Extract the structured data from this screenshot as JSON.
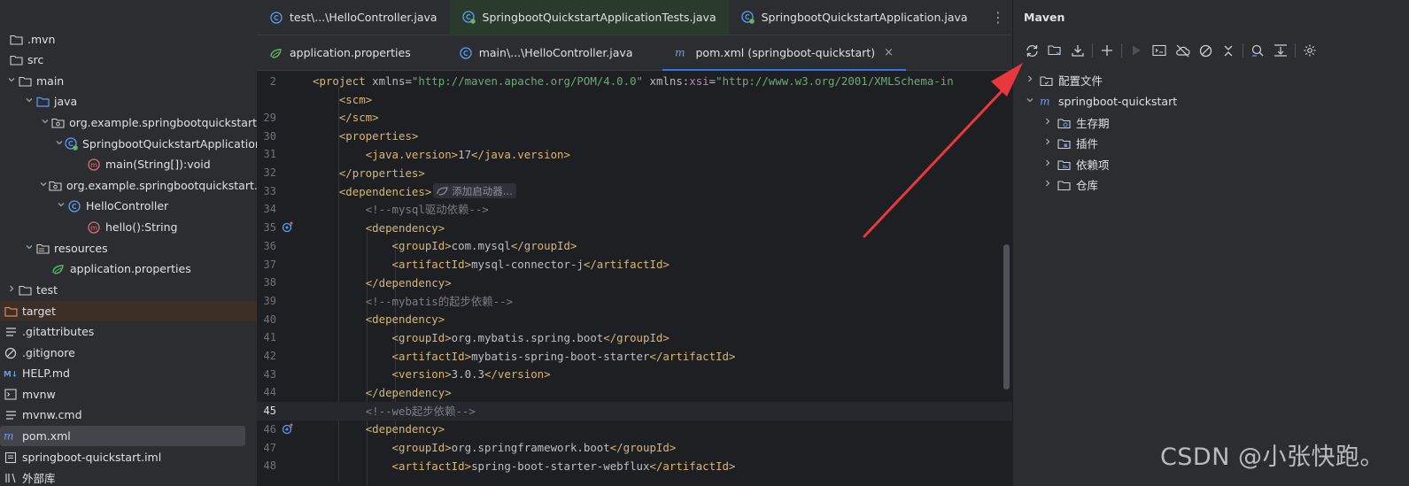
{
  "colors": {
    "accent": "#3574f0",
    "arrow": "#e8383d",
    "tag": "#d5b778",
    "string": "#6aab73",
    "comment": "#7a7e85",
    "namespace": "#c77dbb"
  },
  "tree": {
    "items": [
      {
        "label": ".mvn",
        "icon": "folder-icon"
      },
      {
        "label": "src",
        "icon": "folder-icon"
      },
      {
        "label": "main",
        "icon": "folder-icon"
      },
      {
        "label": "java",
        "icon": "source-folder-icon"
      },
      {
        "label": "org.example.springbootquickstart",
        "icon": "package-icon"
      },
      {
        "label": "SpringbootQuickstartApplication",
        "icon": "spring-class-icon"
      },
      {
        "label": "main(String[]):void",
        "icon": "method-icon"
      },
      {
        "label": "org.example.springbootquickstart.co",
        "icon": "package-icon"
      },
      {
        "label": "HelloController",
        "icon": "class-icon"
      },
      {
        "label": "hello():String",
        "icon": "method-icon"
      },
      {
        "label": "resources",
        "icon": "resources-folder-icon"
      },
      {
        "label": "application.properties",
        "icon": "spring-properties-icon"
      },
      {
        "label": "test",
        "icon": "folder-icon"
      },
      {
        "label": "target",
        "icon": "excluded-folder-icon"
      },
      {
        "label": ".gitattributes",
        "icon": "text-file-icon"
      },
      {
        "label": ".gitignore",
        "icon": "ignore-file-icon"
      },
      {
        "label": "HELP.md",
        "icon": "markdown-icon"
      },
      {
        "label": "mvnw",
        "icon": "shell-file-icon"
      },
      {
        "label": "mvnw.cmd",
        "icon": "text-file-icon"
      },
      {
        "label": "pom.xml",
        "icon": "maven-icon"
      },
      {
        "label": "springboot-quickstart.iml",
        "icon": "iml-file-icon"
      },
      {
        "label": "外部库",
        "icon": "library-icon"
      }
    ]
  },
  "editor": {
    "tabs_row1": [
      {
        "label": "test\\...\\HelloController.java",
        "icon": "class-icon"
      },
      {
        "label": "SpringbootQuickstartApplicationTests.java",
        "icon": "spring-class-icon"
      },
      {
        "label": "SpringbootQuickstartApplication.java",
        "icon": "spring-class-icon"
      }
    ],
    "tabs_row2": [
      {
        "label": "application.properties",
        "icon": "spring-properties-icon"
      },
      {
        "label": "main\\...\\HelloController.java",
        "icon": "class-icon"
      },
      {
        "label": "pom.xml (springboot-quickstart)",
        "icon": "maven-icon",
        "close": "×"
      }
    ],
    "more": "⋮",
    "lines": [
      {
        "n": "2",
        "html": "<span class=\"t\">&lt;project </span><span class=\"an\">xmlns</span>=<span class=\"s\">\"http://maven.apache.org/POM/4.0.0\"</span> <span class=\"an\">xmlns</span>:<span class=\"ns\">xsi</span>=<span class=\"s\">\"http://www.w3.org/2001/XMLSchema-in</span>"
      },
      {
        "n": "",
        "html": "    <span class=\"t\">&lt;scm&gt;</span>"
      },
      {
        "n": "29",
        "html": "    <span class=\"t\">&lt;/scm&gt;</span>"
      },
      {
        "n": "30",
        "html": "    <span class=\"t\">&lt;properties&gt;</span>"
      },
      {
        "n": "31",
        "html": "        <span class=\"t\">&lt;java.version&gt;</span>17<span class=\"t\">&lt;/java.version&gt;</span>"
      },
      {
        "n": "32",
        "html": "    <span class=\"t\">&lt;/properties&gt;</span>"
      },
      {
        "n": "33",
        "html": "    <span class=\"t\">&lt;dependencies&gt;</span>"
      },
      {
        "n": "34",
        "html": "        <span class=\"c\">&lt;!--mysql驱动依赖--&gt;</span>"
      },
      {
        "n": "35",
        "html": "        <span class=\"t\">&lt;dependency&gt;</span>"
      },
      {
        "n": "36",
        "html": "            <span class=\"t\">&lt;groupId&gt;</span>com.mysql<span class=\"t\">&lt;/groupId&gt;</span>"
      },
      {
        "n": "37",
        "html": "            <span class=\"t\">&lt;artifactId&gt;</span>mysql-connector-j<span class=\"t\">&lt;/artifactId&gt;</span>"
      },
      {
        "n": "38",
        "html": "        <span class=\"t\">&lt;/dependency&gt;</span>"
      },
      {
        "n": "39",
        "html": "        <span class=\"c\">&lt;!--mybatis的起步依赖--&gt;</span>"
      },
      {
        "n": "40",
        "html": "        <span class=\"t\">&lt;dependency&gt;</span>"
      },
      {
        "n": "41",
        "html": "            <span class=\"t\">&lt;groupId&gt;</span>org.mybatis.spring.boot<span class=\"t\">&lt;/groupId&gt;</span>"
      },
      {
        "n": "42",
        "html": "            <span class=\"t\">&lt;artifactId&gt;</span>mybatis-spring-boot-starter<span class=\"t\">&lt;/artifactId&gt;</span>"
      },
      {
        "n": "43",
        "html": "            <span class=\"t\">&lt;version&gt;</span>3.0.3<span class=\"t\">&lt;/version&gt;</span>"
      },
      {
        "n": "44",
        "html": "        <span class=\"t\">&lt;/dependency&gt;</span>"
      },
      {
        "n": "45",
        "html": "        <span class=\"c\">&lt;!--web起步依赖--&gt;</span>"
      },
      {
        "n": "46",
        "html": "        <span class=\"t\">&lt;dependency&gt;</span>"
      },
      {
        "n": "47",
        "html": "            <span class=\"t\">&lt;groupId&gt;</span>org.springframework.boot<span class=\"t\">&lt;/groupId&gt;</span>"
      },
      {
        "n": "48",
        "html": "            <span class=\"t\">&lt;artifactId&gt;</span>spring-boot-starter-webflux<span class=\"t\">&lt;/artifactId&gt;</span>"
      }
    ],
    "current_line": "45",
    "inlay_hint": "添加启动器..."
  },
  "maven": {
    "title": "Maven",
    "toolbar": [
      "reload-icon",
      "add-maven-project-icon",
      "download-icon",
      "sep",
      "plus-icon",
      "sep",
      "run-icon",
      "execute-goal-icon",
      "offline-mode-icon",
      "skip-tests-icon",
      "collapse-icon",
      "sep",
      "analyze-dependencies-icon",
      "show-diagram-icon",
      "sep",
      "settings-icon"
    ],
    "tree": [
      {
        "label": "配置文件",
        "icon": "profiles-folder-icon",
        "depth": 0
      },
      {
        "label": "springboot-quickstart",
        "icon": "maven-icon",
        "depth": 0,
        "expanded": true
      },
      {
        "label": "生存期",
        "icon": "lifecycle-folder-icon",
        "depth": 1
      },
      {
        "label": "插件",
        "icon": "plugins-folder-icon",
        "depth": 1
      },
      {
        "label": "依赖项",
        "icon": "dependencies-folder-icon",
        "depth": 1
      },
      {
        "label": "仓库",
        "icon": "repositories-folder-icon",
        "depth": 1
      }
    ]
  },
  "watermark": "CSDN @小张快跑。"
}
